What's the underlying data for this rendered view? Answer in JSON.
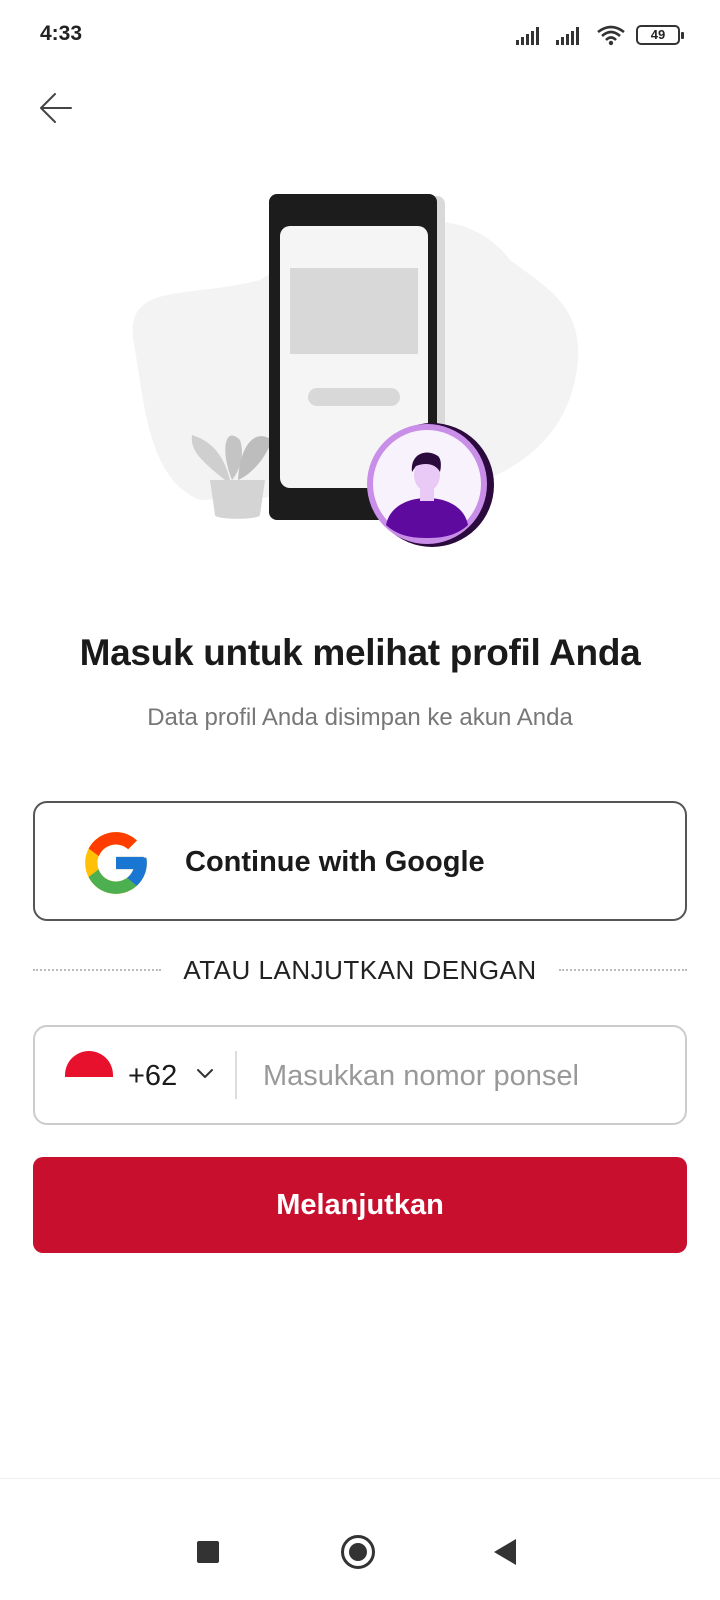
{
  "status_bar": {
    "time": "4:33",
    "battery": "49"
  },
  "header": {
    "back_icon": "arrow-left-icon"
  },
  "illustration": {
    "description_icon": "phone-profile-illustration"
  },
  "login": {
    "title": "Masuk untuk melihat profil Anda",
    "subtitle": "Data profil Anda disimpan ke akun Anda",
    "google_button_label": "Continue with Google",
    "divider_text": "ATAU LANJUTKAN DENGAN",
    "country_code": "+62",
    "phone_placeholder": "Masukkan nomor ponsel",
    "continue_label": "Melanjutkan"
  },
  "colors": {
    "primary": "#c8102e",
    "avatar_purple": "#6a0dad",
    "flag_red": "#e8112d"
  },
  "nav_bar": {
    "icons": [
      "recent-apps-icon",
      "home-icon",
      "back-triangle-icon"
    ]
  }
}
